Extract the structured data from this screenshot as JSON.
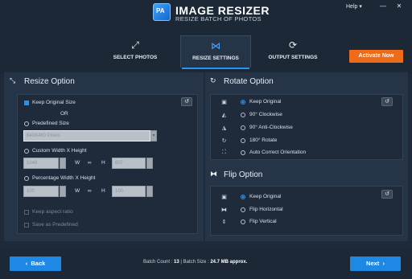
{
  "app": {
    "title": "IMAGE RESIZER",
    "subtitle": "RESIZE BATCH OF PHOTOS",
    "logo_text": "PA"
  },
  "topbar": {
    "help_label": "Help ▾",
    "minimize": "—",
    "close": "✕"
  },
  "tabs": [
    {
      "label": "SELECT PHOTOS",
      "icon": "expand-arrows-icon",
      "glyph": "⤢"
    },
    {
      "label": "RESIZE SETTINGS",
      "icon": "resize-compress-icon",
      "glyph": "⋈"
    },
    {
      "label": "OUTPUT SETTINGS",
      "icon": "output-rotate-icon",
      "glyph": "⟳"
    }
  ],
  "activate_label": "Activate Now",
  "resize": {
    "title": "Resize Option",
    "keep_original": "Keep Original Size",
    "or_text": "OR",
    "predefined": "Predefined Size",
    "predefined_value": "640X480 Pixels",
    "custom": "Custom Width X Height",
    "custom_w": "1048",
    "custom_h": "607",
    "percentage": "Percentage Width X Height",
    "pct_w": "100",
    "pct_h": "100",
    "w_label": "W",
    "h_label": "H",
    "link_glyph": "∞",
    "keep_aspect": "Keep aspect ratio",
    "save_predefined": "Save as Predefined"
  },
  "rotate": {
    "title": "Rotate Option",
    "options": [
      "Keep Original",
      "90° Clockwise",
      "90° Anti-Clockwise",
      "180° Rotate",
      "Auto Correct Orientation"
    ],
    "selected": 0
  },
  "flip": {
    "title": "Flip Option",
    "options": [
      "Keep Original",
      "Flip Horizontal",
      "Flip Vertical"
    ],
    "selected": 0
  },
  "footer": {
    "back": "Back",
    "next": "Next",
    "batch_count_label": "Batch Count :",
    "batch_count": "13",
    "batch_size_label": "| Batch Size :",
    "batch_size": "24.7 MB approx."
  },
  "colors": {
    "accent": "#1e88e5",
    "activate": "#ee6b1a",
    "background": "#1e2a3a",
    "panel": "#263447"
  }
}
